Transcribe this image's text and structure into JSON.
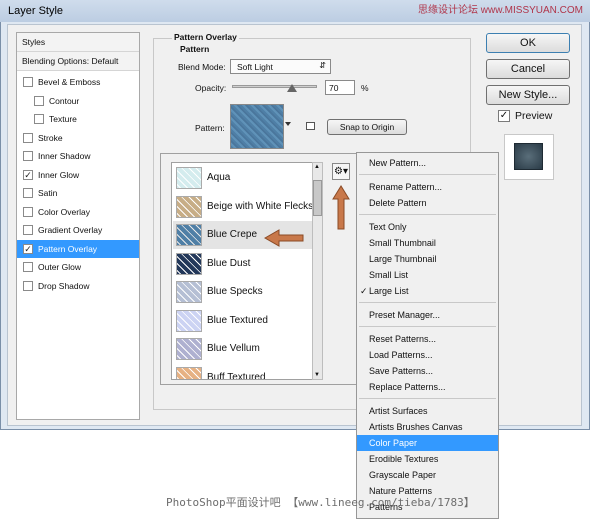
{
  "window": {
    "title": "Layer Style"
  },
  "watermark_top": "思缘设计论坛 www.MISSYUAN.COM",
  "styles_list": {
    "header": "Styles",
    "blending": "Blending Options: Default",
    "items": [
      {
        "label": "Bevel & Emboss",
        "checked": false,
        "indent": false
      },
      {
        "label": "Contour",
        "checked": false,
        "indent": true
      },
      {
        "label": "Texture",
        "checked": false,
        "indent": true
      },
      {
        "label": "Stroke",
        "checked": false,
        "indent": false
      },
      {
        "label": "Inner Shadow",
        "checked": false,
        "indent": false
      },
      {
        "label": "Inner Glow",
        "checked": true,
        "indent": false
      },
      {
        "label": "Satin",
        "checked": false,
        "indent": false
      },
      {
        "label": "Color Overlay",
        "checked": false,
        "indent": false
      },
      {
        "label": "Gradient Overlay",
        "checked": false,
        "indent": false
      },
      {
        "label": "Pattern Overlay",
        "checked": true,
        "indent": false,
        "selected": true
      },
      {
        "label": "Outer Glow",
        "checked": false,
        "indent": false
      },
      {
        "label": "Drop Shadow",
        "checked": false,
        "indent": false
      }
    ]
  },
  "panel": {
    "title": "Pattern Overlay",
    "subtitle": "Pattern",
    "blend_mode_label": "Blend Mode:",
    "blend_mode_value": "Soft Light",
    "opacity_label": "Opacity:",
    "opacity_value": "70",
    "opacity_unit": "%",
    "opacity_level": 0.7,
    "pattern_label": "Pattern:",
    "snap_button": "Snap to Origin"
  },
  "buttons": {
    "ok": "OK",
    "cancel": "Cancel",
    "new_style": "New Style...",
    "preview_label": "Preview",
    "preview_checked": true
  },
  "patterns": [
    {
      "name": "Aqua",
      "color": "#d4ecee"
    },
    {
      "name": "Beige with White Flecks",
      "color": "#c7ad86"
    },
    {
      "name": "Blue Crepe",
      "color": "#4f7fa6"
    },
    {
      "name": "Blue Dust",
      "color": "#23385a"
    },
    {
      "name": "Blue Specks",
      "color": "#b5bfd4"
    },
    {
      "name": "Blue Textured",
      "color": "#ccd3f3"
    },
    {
      "name": "Blue Vellum",
      "color": "#aeb0d0"
    },
    {
      "name": "Buff Textured",
      "color": "#e6b183"
    }
  ],
  "menu": {
    "groups": [
      [
        {
          "label": "New Pattern..."
        }
      ],
      [
        {
          "label": "Rename Pattern..."
        },
        {
          "label": "Delete Pattern"
        }
      ],
      [
        {
          "label": "Text Only"
        },
        {
          "label": "Small Thumbnail"
        },
        {
          "label": "Large Thumbnail"
        },
        {
          "label": "Small List"
        },
        {
          "label": "Large List",
          "checked": true
        }
      ],
      [
        {
          "label": "Preset Manager..."
        }
      ],
      [
        {
          "label": "Reset Patterns..."
        },
        {
          "label": "Load Patterns..."
        },
        {
          "label": "Save Patterns..."
        },
        {
          "label": "Replace Patterns..."
        }
      ],
      [
        {
          "label": "Artist Surfaces"
        },
        {
          "label": "Artists Brushes Canvas"
        },
        {
          "label": "Color Paper",
          "highlighted": true
        },
        {
          "label": "Erodible Textures"
        },
        {
          "label": "Grayscale Paper"
        },
        {
          "label": "Nature Patterns"
        },
        {
          "label": "Patterns"
        }
      ]
    ]
  },
  "watermark_bottom": "PhotoShop平面设计吧 【www.lineeg.com/tieba/1783】",
  "colors": {
    "selection": "#3399ff",
    "arrow": "#c8784a"
  }
}
